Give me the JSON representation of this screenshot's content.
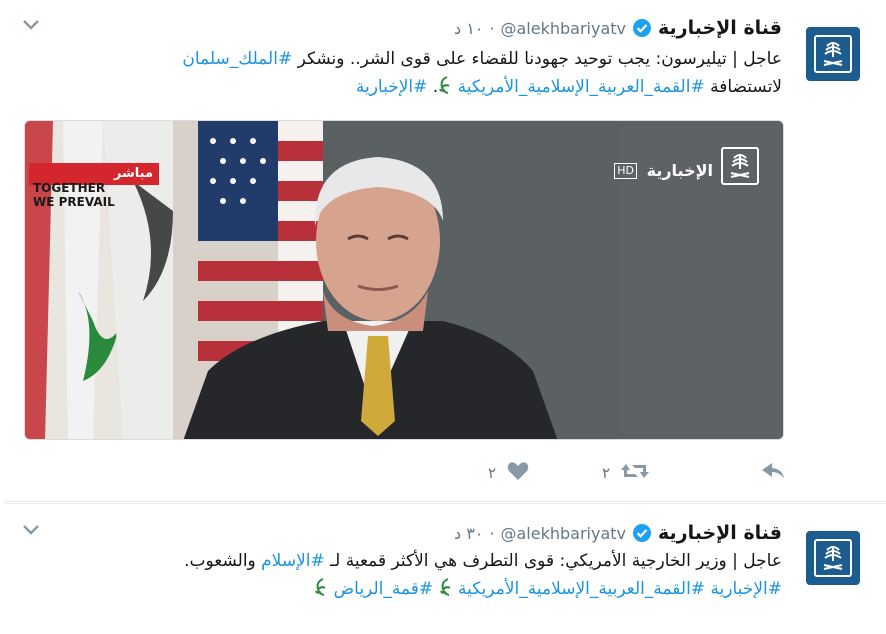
{
  "tweets": [
    {
      "display_name": "قناة الإخبارية",
      "handle": "@alekhbariyatv",
      "dot": "·",
      "time": "١٠ د",
      "text_lines": [
        {
          "segments": [
            {
              "text": "عاجل | تيليرسون: يجب توحيد جهودنا للقضاء على قوى الشر.. ونشكر ",
              "type": "plain"
            },
            {
              "text": "#الملك_سلمان",
              "type": "hashtag"
            }
          ]
        },
        {
          "segments": [
            {
              "text": "لاتستضافة ",
              "type": "plain"
            },
            {
              "text": "#القمة_العربية_الإسلامية_الأمريكية",
              "type": "hashtag"
            },
            {
              "text": " ",
              "type": "plain"
            },
            {
              "text": "leaf",
              "type": "emoji"
            },
            {
              "text": ". ",
              "type": "plain"
            },
            {
              "text": "#الإخبارية",
              "type": "hashtag"
            }
          ]
        }
      ],
      "media": {
        "live_label": "مباشر",
        "channel_name": "الإخبارية",
        "channel_hd": "HD",
        "summit_lines": [
          "TOGETHER",
          "WE PREVAIL"
        ]
      },
      "actions": {
        "reply_icon": "reply-icon",
        "retweet_icon": "retweet-icon",
        "retweet_count": "٢",
        "like_icon": "heart-icon",
        "like_count": "٢"
      }
    },
    {
      "display_name": "قناة الإخبارية",
      "handle": "@alekhbariyatv",
      "dot": "·",
      "time": "٣٠ د",
      "text_lines": [
        {
          "segments": [
            {
              "text": "عاجل | وزير الخارجية الأمريكي: قوى التطرف هي الأكثر قمعية لـ ",
              "type": "plain"
            },
            {
              "text": "#الإسلام",
              "type": "hashtag"
            },
            {
              "text": " والشعوب.",
              "type": "plain"
            }
          ]
        },
        {
          "segments": [
            {
              "text": "#الإخبارية",
              "type": "hashtag"
            },
            {
              "text": " ",
              "type": "plain"
            },
            {
              "text": "#القمة_العربية_الإسلامية_الأمريكية",
              "type": "hashtag"
            },
            {
              "text": " ",
              "type": "plain"
            },
            {
              "text": "leaf",
              "type": "emoji"
            },
            {
              "text": " ",
              "type": "plain"
            },
            {
              "text": "#قمة_الرياض",
              "type": "hashtag"
            },
            {
              "text": " ",
              "type": "plain"
            },
            {
              "text": "leaf",
              "type": "emoji"
            }
          ]
        }
      ]
    }
  ],
  "colors": {
    "link": "#1b95e0",
    "text": "#14171a",
    "muted": "#657786",
    "verified": "#1da1f2",
    "avatar": "#1d5c8f",
    "emoji_leaf": "#2e8b3e",
    "live_red": "#d3262d"
  },
  "icons": [
    "verified-badge-icon",
    "chevron-down-icon",
    "reply-icon",
    "retweet-icon",
    "heart-icon",
    "channel-emblem-icon",
    "leaf-emoji-icon"
  ]
}
